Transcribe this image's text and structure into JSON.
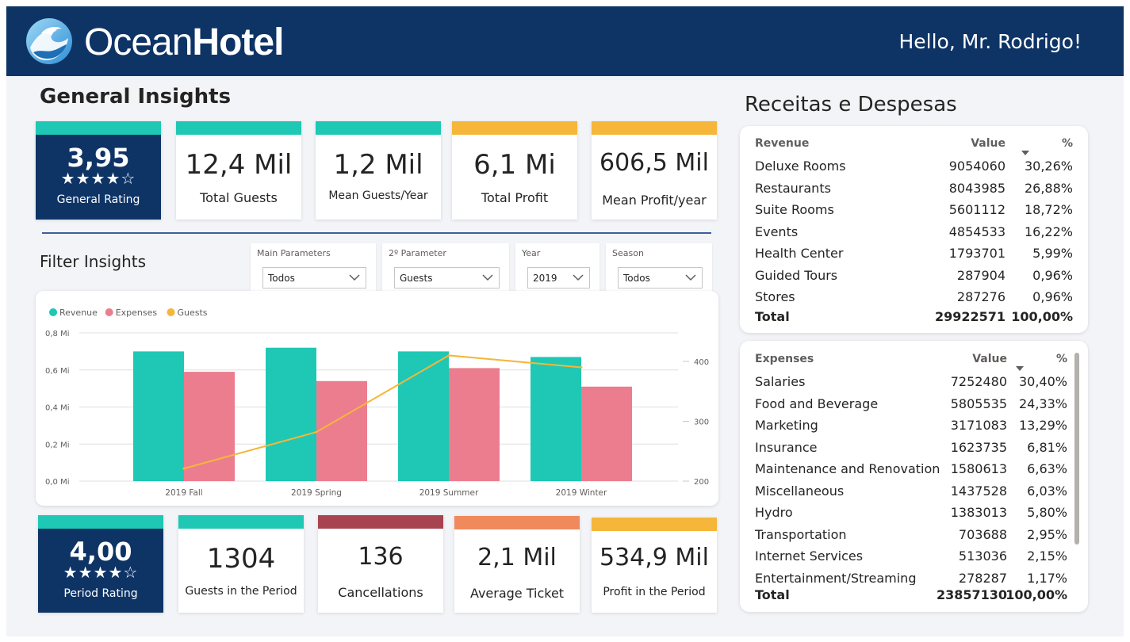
{
  "header": {
    "brand_light": "Ocean",
    "brand_bold": "Hotel",
    "greeting": "Hello, Mr. Rodrigo!"
  },
  "general": {
    "title": "General Insights",
    "rating": {
      "value": "3,95",
      "stars": "★★★★☆",
      "label": "General Rating",
      "color": "#0e3466"
    },
    "cards": [
      {
        "value": "12,4 Mil",
        "label": "Total Guests",
        "color": "#1ec8b4"
      },
      {
        "value": "1,2 Mil",
        "label": "Mean Guests/Year",
        "color": "#1ec8b4"
      },
      {
        "value": "6,1 Mi",
        "label": "Total Profit",
        "color": "#f5b63a"
      },
      {
        "value": "606,5 Mil",
        "label": "Mean Profit/year",
        "color": "#f5b63a"
      }
    ]
  },
  "filter": {
    "title": "Filter Insights",
    "slicers": [
      {
        "label": "Main Parameters",
        "value": "Todos"
      },
      {
        "label": "2º Parameter",
        "value": "Guests"
      },
      {
        "label": "Year",
        "value": "2019"
      },
      {
        "label": "Season",
        "value": "Todos"
      }
    ]
  },
  "period": {
    "rating": {
      "value": "4,00",
      "stars": "★★★★☆",
      "label": "Period Rating"
    },
    "cards": [
      {
        "value": "1304",
        "label": "Guests in the Period",
        "color": "#1ec8b4"
      },
      {
        "value": "136",
        "label": "Cancellations",
        "color": "#a8444f"
      },
      {
        "value": "2,1 Mil",
        "label": "Average Ticket",
        "color": "#f08a5d"
      },
      {
        "value": "534,9 Mil",
        "label": "Profit in the Period",
        "color": "#f5b63a"
      }
    ]
  },
  "chart_data": {
    "type": "bar",
    "categories": [
      "2019 Fall",
      "2019 Spring",
      "2019 Summer",
      "2019 Winter"
    ],
    "series": [
      {
        "name": "Revenue",
        "type": "bar",
        "axis": "left",
        "color": "#1ec8b4",
        "values": [
          0.7,
          0.72,
          0.7,
          0.67
        ]
      },
      {
        "name": "Expenses",
        "type": "bar",
        "axis": "left",
        "color": "#ec7d8f",
        "values": [
          0.59,
          0.54,
          0.61,
          0.51
        ]
      },
      {
        "name": "Guests",
        "type": "line",
        "axis": "right",
        "color": "#f5b63a",
        "values": [
          221,
          282,
          410,
          390
        ]
      }
    ],
    "y_left": {
      "min": 0,
      "max": 0.8,
      "ticks": [
        0,
        0.2,
        0.4,
        0.6,
        0.8
      ],
      "tick_labels": [
        "0,0 Mi",
        "0,2 Mi",
        "0,4 Mi",
        "0,6 Mi",
        "0,8 Mi"
      ]
    },
    "y_right": {
      "min": 200,
      "max": 400,
      "ticks": [
        200,
        300,
        400
      ],
      "tick_labels": [
        "200",
        "300",
        "400"
      ]
    },
    "legend_position": "top-left",
    "grid": true
  },
  "finance": {
    "title": "Receitas e Despesas",
    "revenue": {
      "headers": [
        "Revenue",
        "Value",
        "%"
      ],
      "rows": [
        [
          "Deluxe Rooms",
          "9054060",
          "30,26%"
        ],
        [
          "Restaurants",
          "8043985",
          "26,88%"
        ],
        [
          "Suite Rooms",
          "5601112",
          "18,72%"
        ],
        [
          "Events",
          "4854533",
          "16,22%"
        ],
        [
          "Health Center",
          "1793701",
          "5,99%"
        ],
        [
          "Guided Tours",
          "287904",
          "0,96%"
        ],
        [
          "Stores",
          "287276",
          "0,96%"
        ]
      ],
      "total": [
        "Total",
        "29922571",
        "100,00%"
      ]
    },
    "expenses": {
      "headers": [
        "Expenses",
        "Value",
        "%"
      ],
      "rows": [
        [
          "Salaries",
          "7252480",
          "30,40%"
        ],
        [
          "Food and Beverage",
          "5805535",
          "24,33%"
        ],
        [
          "Marketing",
          "3171083",
          "13,29%"
        ],
        [
          "Insurance",
          "1623735",
          "6,81%"
        ],
        [
          "Maintenance and Renovation",
          "1580613",
          "6,63%"
        ],
        [
          "Miscellaneous",
          "1437528",
          "6,03%"
        ],
        [
          "Hydro",
          "1383013",
          "5,80%"
        ],
        [
          "Transportation",
          "703688",
          "2,95%"
        ],
        [
          "Internet Services",
          "513036",
          "2,15%"
        ],
        [
          "Entertainment/Streaming",
          "278287",
          "1,17%"
        ]
      ],
      "total": [
        "Total",
        "23857130",
        "100,00%"
      ]
    }
  }
}
